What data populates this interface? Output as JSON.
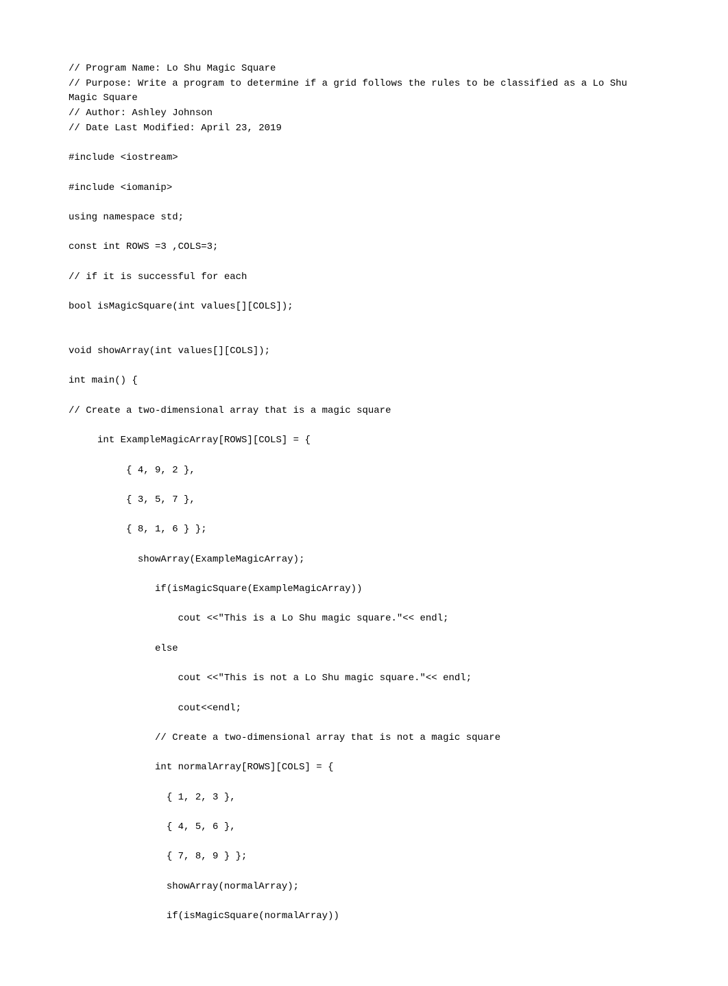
{
  "code_text": "// Program Name: Lo Shu Magic Square\n// Purpose: Write a program to determine if a grid follows the rules to be classified as a Lo Shu Magic Square\n// Author: Ashley Johnson\n// Date Last Modified: April 23, 2019\n\n#include <iostream>\n\n#include <iomanip>\n\nusing namespace std;\n\nconst int ROWS =3 ,COLS=3;\n\n// if it is successful for each\n\nbool isMagicSquare(int values[][COLS]);\n\n\nvoid showArray(int values[][COLS]);\n\nint main() {\n\n// Create a two-dimensional array that is a magic square\n\n     int ExampleMagicArray[ROWS][COLS] = {\n\n          { 4, 9, 2 },\n\n          { 3, 5, 7 },\n\n          { 8, 1, 6 } };\n\n            showArray(ExampleMagicArray);\n\n               if(isMagicSquare(ExampleMagicArray))\n\n                   cout <<\"This is a Lo Shu magic square.\"<< endl;\n\n               else\n\n                   cout <<\"This is not a Lo Shu magic square.\"<< endl;\n\n                   cout<<endl;\n\n               // Create a two-dimensional array that is not a magic square\n\n               int normalArray[ROWS][COLS] = {\n\n                 { 1, 2, 3 },\n\n                 { 4, 5, 6 },\n\n                 { 7, 8, 9 } };\n\n                 showArray(normalArray);\n\n                 if(isMagicSquare(normalArray))"
}
